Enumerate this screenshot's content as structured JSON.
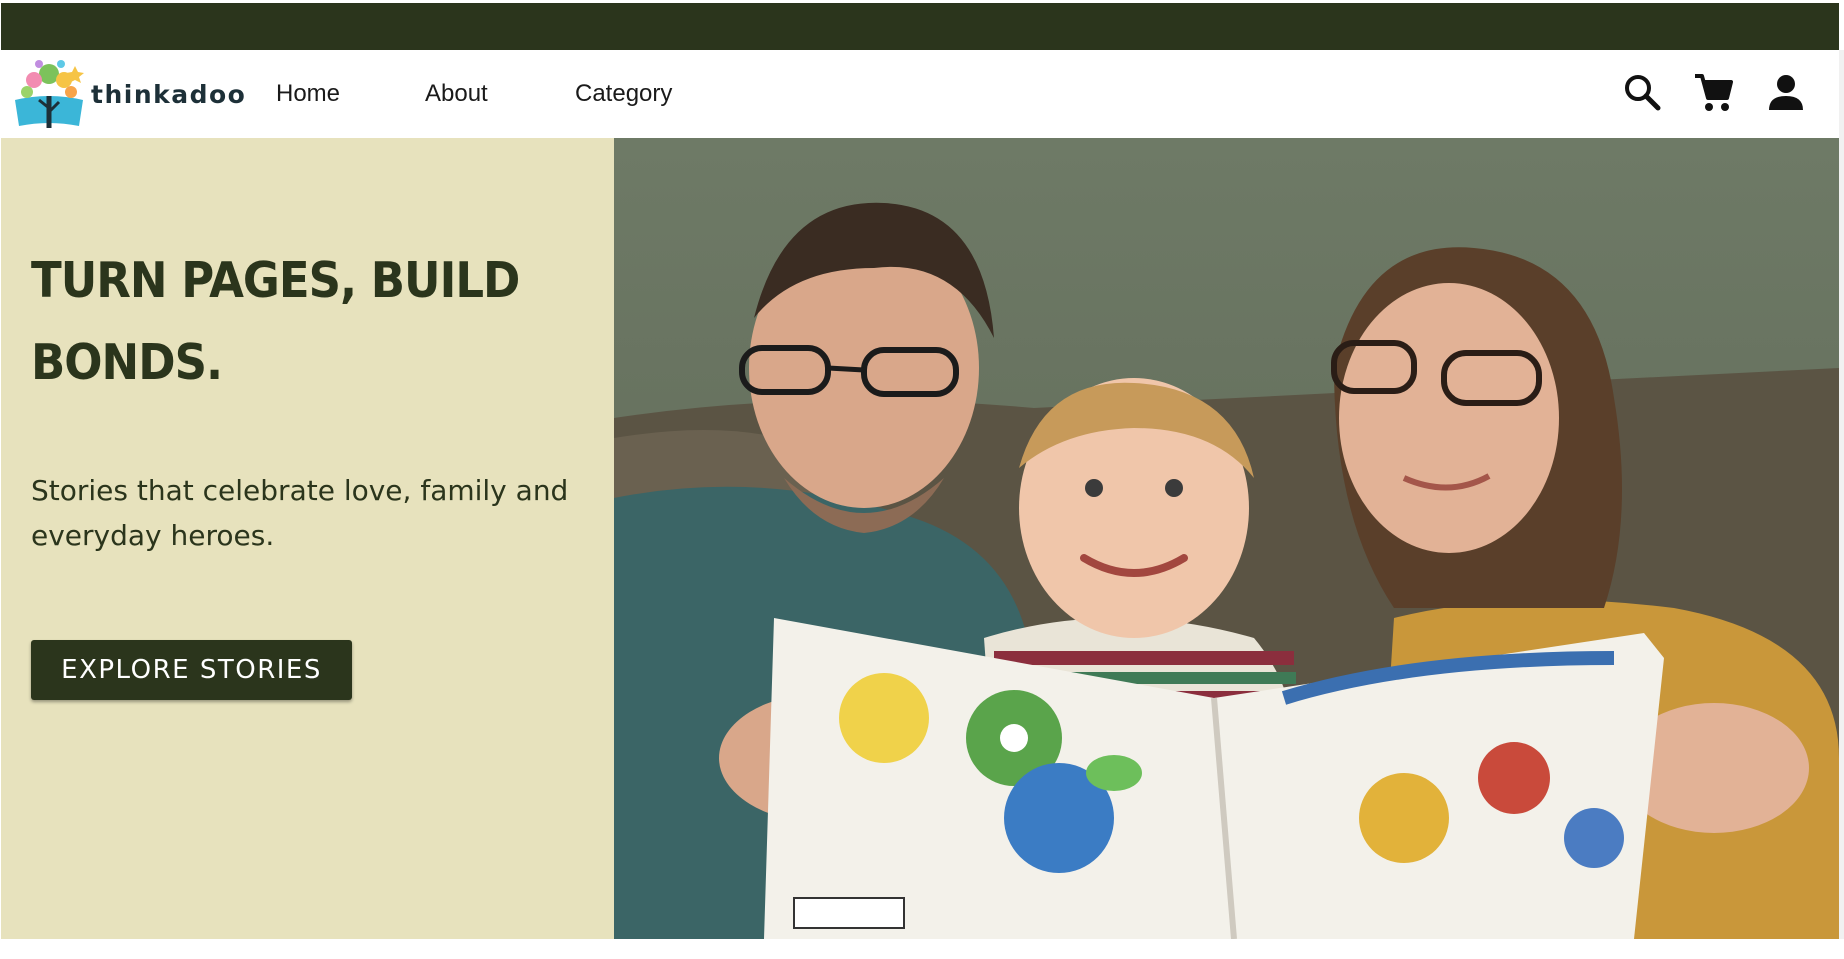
{
  "brand": {
    "name": "thinkadoo"
  },
  "nav": {
    "items": [
      {
        "label": "Home"
      },
      {
        "label": "About"
      },
      {
        "label": "Category"
      }
    ],
    "icons": [
      "search-icon",
      "cart-icon",
      "user-icon"
    ]
  },
  "hero": {
    "title": "TURN PAGES, BUILD BONDS.",
    "subtitle": "Stories that celebrate love, family and everyday heroes.",
    "cta_label": "EXPLORE STORIES",
    "image_alt": "Family reading a picture book together on a couch"
  },
  "colors": {
    "accent": "#2b351c",
    "hero_bg": "#e7e2bd",
    "nav_bg": "#ffffff"
  }
}
